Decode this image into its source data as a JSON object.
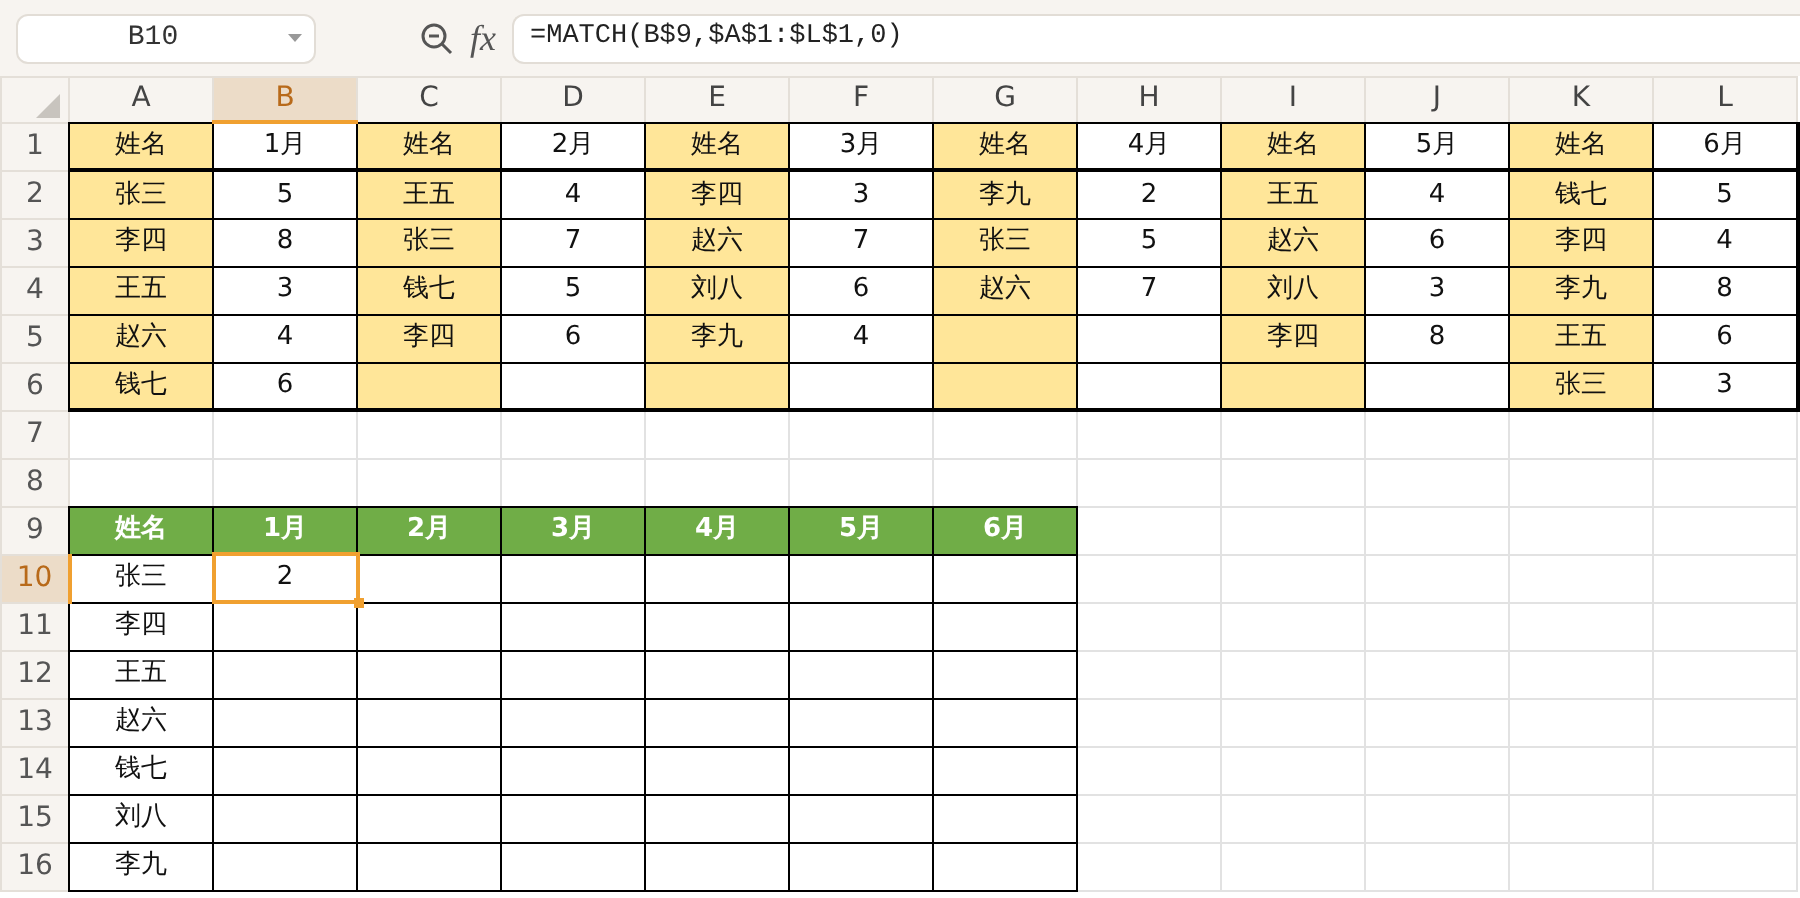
{
  "name_box": "B10",
  "formula_bar": {
    "fx": "fx",
    "formula": "=MATCH(B$9,$A$1:$L$1,0)"
  },
  "column_headers": [
    {
      "label": "A",
      "selected": false
    },
    {
      "label": "B",
      "selected": true
    },
    {
      "label": "C",
      "selected": false
    },
    {
      "label": "D",
      "selected": false
    },
    {
      "label": "E",
      "selected": false
    },
    {
      "label": "F",
      "selected": false
    },
    {
      "label": "G",
      "selected": false
    },
    {
      "label": "H",
      "selected": false
    },
    {
      "label": "I",
      "selected": false
    },
    {
      "label": "J",
      "selected": false
    },
    {
      "label": "K",
      "selected": false
    },
    {
      "label": "L",
      "selected": false
    }
  ],
  "rows": [
    {
      "number": "1",
      "selected": false,
      "thick_bottom": true,
      "cells": [
        {
          "text": "姓名",
          "kind": "name"
        },
        {
          "text": "1月",
          "kind": "value"
        },
        {
          "text": "姓名",
          "kind": "name"
        },
        {
          "text": "2月",
          "kind": "value"
        },
        {
          "text": "姓名",
          "kind": "name"
        },
        {
          "text": "3月",
          "kind": "value"
        },
        {
          "text": "姓名",
          "kind": "name"
        },
        {
          "text": "4月",
          "kind": "value"
        },
        {
          "text": "姓名",
          "kind": "name"
        },
        {
          "text": "5月",
          "kind": "value"
        },
        {
          "text": "姓名",
          "kind": "name"
        },
        {
          "text": "6月",
          "kind": "value",
          "thick_right": true
        }
      ]
    },
    {
      "number": "2",
      "selected": false,
      "thick_bottom": false,
      "cells": [
        {
          "text": "张三",
          "kind": "name"
        },
        {
          "text": "5",
          "kind": "value"
        },
        {
          "text": "王五",
          "kind": "name"
        },
        {
          "text": "4",
          "kind": "value"
        },
        {
          "text": "李四",
          "kind": "name"
        },
        {
          "text": "3",
          "kind": "value"
        },
        {
          "text": "李九",
          "kind": "name"
        },
        {
          "text": "2",
          "kind": "value"
        },
        {
          "text": "王五",
          "kind": "name"
        },
        {
          "text": "4",
          "kind": "value"
        },
        {
          "text": "钱七",
          "kind": "name"
        },
        {
          "text": "5",
          "kind": "value",
          "thick_right": true
        }
      ]
    },
    {
      "number": "3",
      "selected": false,
      "thick_bottom": false,
      "cells": [
        {
          "text": "李四",
          "kind": "name"
        },
        {
          "text": "8",
          "kind": "value"
        },
        {
          "text": "张三",
          "kind": "name"
        },
        {
          "text": "7",
          "kind": "value"
        },
        {
          "text": "赵六",
          "kind": "name"
        },
        {
          "text": "7",
          "kind": "value"
        },
        {
          "text": "张三",
          "kind": "name"
        },
        {
          "text": "5",
          "kind": "value"
        },
        {
          "text": "赵六",
          "kind": "name"
        },
        {
          "text": "6",
          "kind": "value"
        },
        {
          "text": "李四",
          "kind": "name"
        },
        {
          "text": "4",
          "kind": "value",
          "thick_right": true
        }
      ]
    },
    {
      "number": "4",
      "selected": false,
      "thick_bottom": false,
      "cells": [
        {
          "text": "王五",
          "kind": "name"
        },
        {
          "text": "3",
          "kind": "value"
        },
        {
          "text": "钱七",
          "kind": "name"
        },
        {
          "text": "5",
          "kind": "value"
        },
        {
          "text": "刘八",
          "kind": "name"
        },
        {
          "text": "6",
          "kind": "value"
        },
        {
          "text": "赵六",
          "kind": "name"
        },
        {
          "text": "7",
          "kind": "value"
        },
        {
          "text": "刘八",
          "kind": "name"
        },
        {
          "text": "3",
          "kind": "value"
        },
        {
          "text": "李九",
          "kind": "name"
        },
        {
          "text": "8",
          "kind": "value",
          "thick_right": true
        }
      ]
    },
    {
      "number": "5",
      "selected": false,
      "thick_bottom": false,
      "cells": [
        {
          "text": "赵六",
          "kind": "name"
        },
        {
          "text": "4",
          "kind": "value"
        },
        {
          "text": "李四",
          "kind": "name"
        },
        {
          "text": "6",
          "kind": "value"
        },
        {
          "text": "李九",
          "kind": "name"
        },
        {
          "text": "4",
          "kind": "value"
        },
        {
          "kind": "name"
        },
        {
          "kind": "value"
        },
        {
          "text": "李四",
          "kind": "name"
        },
        {
          "text": "8",
          "kind": "value"
        },
        {
          "text": "王五",
          "kind": "name"
        },
        {
          "text": "6",
          "kind": "value",
          "thick_right": true
        }
      ]
    },
    {
      "number": "6",
      "selected": false,
      "thick_bottom": true,
      "cells": [
        {
          "text": "钱七",
          "kind": "name"
        },
        {
          "text": "6",
          "kind": "value"
        },
        {
          "kind": "name"
        },
        {
          "kind": "value"
        },
        {
          "kind": "name"
        },
        {
          "kind": "value"
        },
        {
          "kind": "name"
        },
        {
          "kind": "value"
        },
        {
          "kind": "name"
        },
        {
          "kind": "value"
        },
        {
          "text": "张三",
          "kind": "name"
        },
        {
          "text": "3",
          "kind": "value",
          "thick_right": true
        }
      ]
    },
    {
      "number": "7",
      "selected": false,
      "thick_bottom": false
    },
    {
      "number": "8",
      "selected": false,
      "thick_bottom": false
    },
    {
      "number": "9",
      "selected": false,
      "thick_bottom": false,
      "cells": [
        {
          "text": "姓名",
          "kind": "header"
        },
        {
          "text": "1月",
          "kind": "header"
        },
        {
          "text": "2月",
          "kind": "header"
        },
        {
          "text": "3月",
          "kind": "header"
        },
        {
          "text": "4月",
          "kind": "header"
        },
        {
          "text": "5月",
          "kind": "header"
        },
        {
          "text": "6月",
          "kind": "header"
        }
      ]
    },
    {
      "number": "10",
      "selected": true,
      "thick_bottom": false,
      "cells": [
        {
          "text": "张三",
          "kind": "plain"
        },
        {
          "text": "2",
          "kind": "plain"
        },
        {
          "kind": "plain"
        },
        {
          "kind": "plain"
        },
        {
          "kind": "plain"
        },
        {
          "kind": "plain"
        },
        {
          "kind": "plain"
        }
      ]
    },
    {
      "number": "11",
      "selected": false,
      "thick_bottom": false,
      "cells": [
        {
          "text": "李四",
          "kind": "plain"
        },
        {
          "kind": "plain"
        },
        {
          "kind": "plain"
        },
        {
          "kind": "plain"
        },
        {
          "kind": "plain"
        },
        {
          "kind": "plain"
        },
        {
          "kind": "plain"
        }
      ]
    },
    {
      "number": "12",
      "selected": false,
      "thick_bottom": false,
      "cells": [
        {
          "text": "王五",
          "kind": "plain"
        },
        {
          "kind": "plain"
        },
        {
          "kind": "plain"
        },
        {
          "kind": "plain"
        },
        {
          "kind": "plain"
        },
        {
          "kind": "plain"
        },
        {
          "kind": "plain"
        }
      ]
    },
    {
      "number": "13",
      "selected": false,
      "thick_bottom": false,
      "cells": [
        {
          "text": "赵六",
          "kind": "plain"
        },
        {
          "kind": "plain"
        },
        {
          "kind": "plain"
        },
        {
          "kind": "plain"
        },
        {
          "kind": "plain"
        },
        {
          "kind": "plain"
        },
        {
          "kind": "plain"
        }
      ]
    },
    {
      "number": "14",
      "selected": false,
      "thick_bottom": false,
      "cells": [
        {
          "text": "钱七",
          "kind": "plain"
        },
        {
          "kind": "plain"
        },
        {
          "kind": "plain"
        },
        {
          "kind": "plain"
        },
        {
          "kind": "plain"
        },
        {
          "kind": "plain"
        },
        {
          "kind": "plain"
        }
      ]
    },
    {
      "number": "15",
      "selected": false,
      "thick_bottom": false,
      "cells": [
        {
          "text": "刘八",
          "kind": "plain"
        },
        {
          "kind": "plain"
        },
        {
          "kind": "plain"
        },
        {
          "kind": "plain"
        },
        {
          "kind": "plain"
        },
        {
          "kind": "plain"
        },
        {
          "kind": "plain"
        }
      ]
    },
    {
      "number": "16",
      "selected": false,
      "thick_bottom": false,
      "cells": [
        {
          "text": "李九",
          "kind": "plain"
        },
        {
          "kind": "plain"
        },
        {
          "kind": "plain"
        },
        {
          "kind": "plain"
        },
        {
          "kind": "plain"
        },
        {
          "kind": "plain"
        },
        {
          "kind": "plain"
        }
      ]
    }
  ]
}
